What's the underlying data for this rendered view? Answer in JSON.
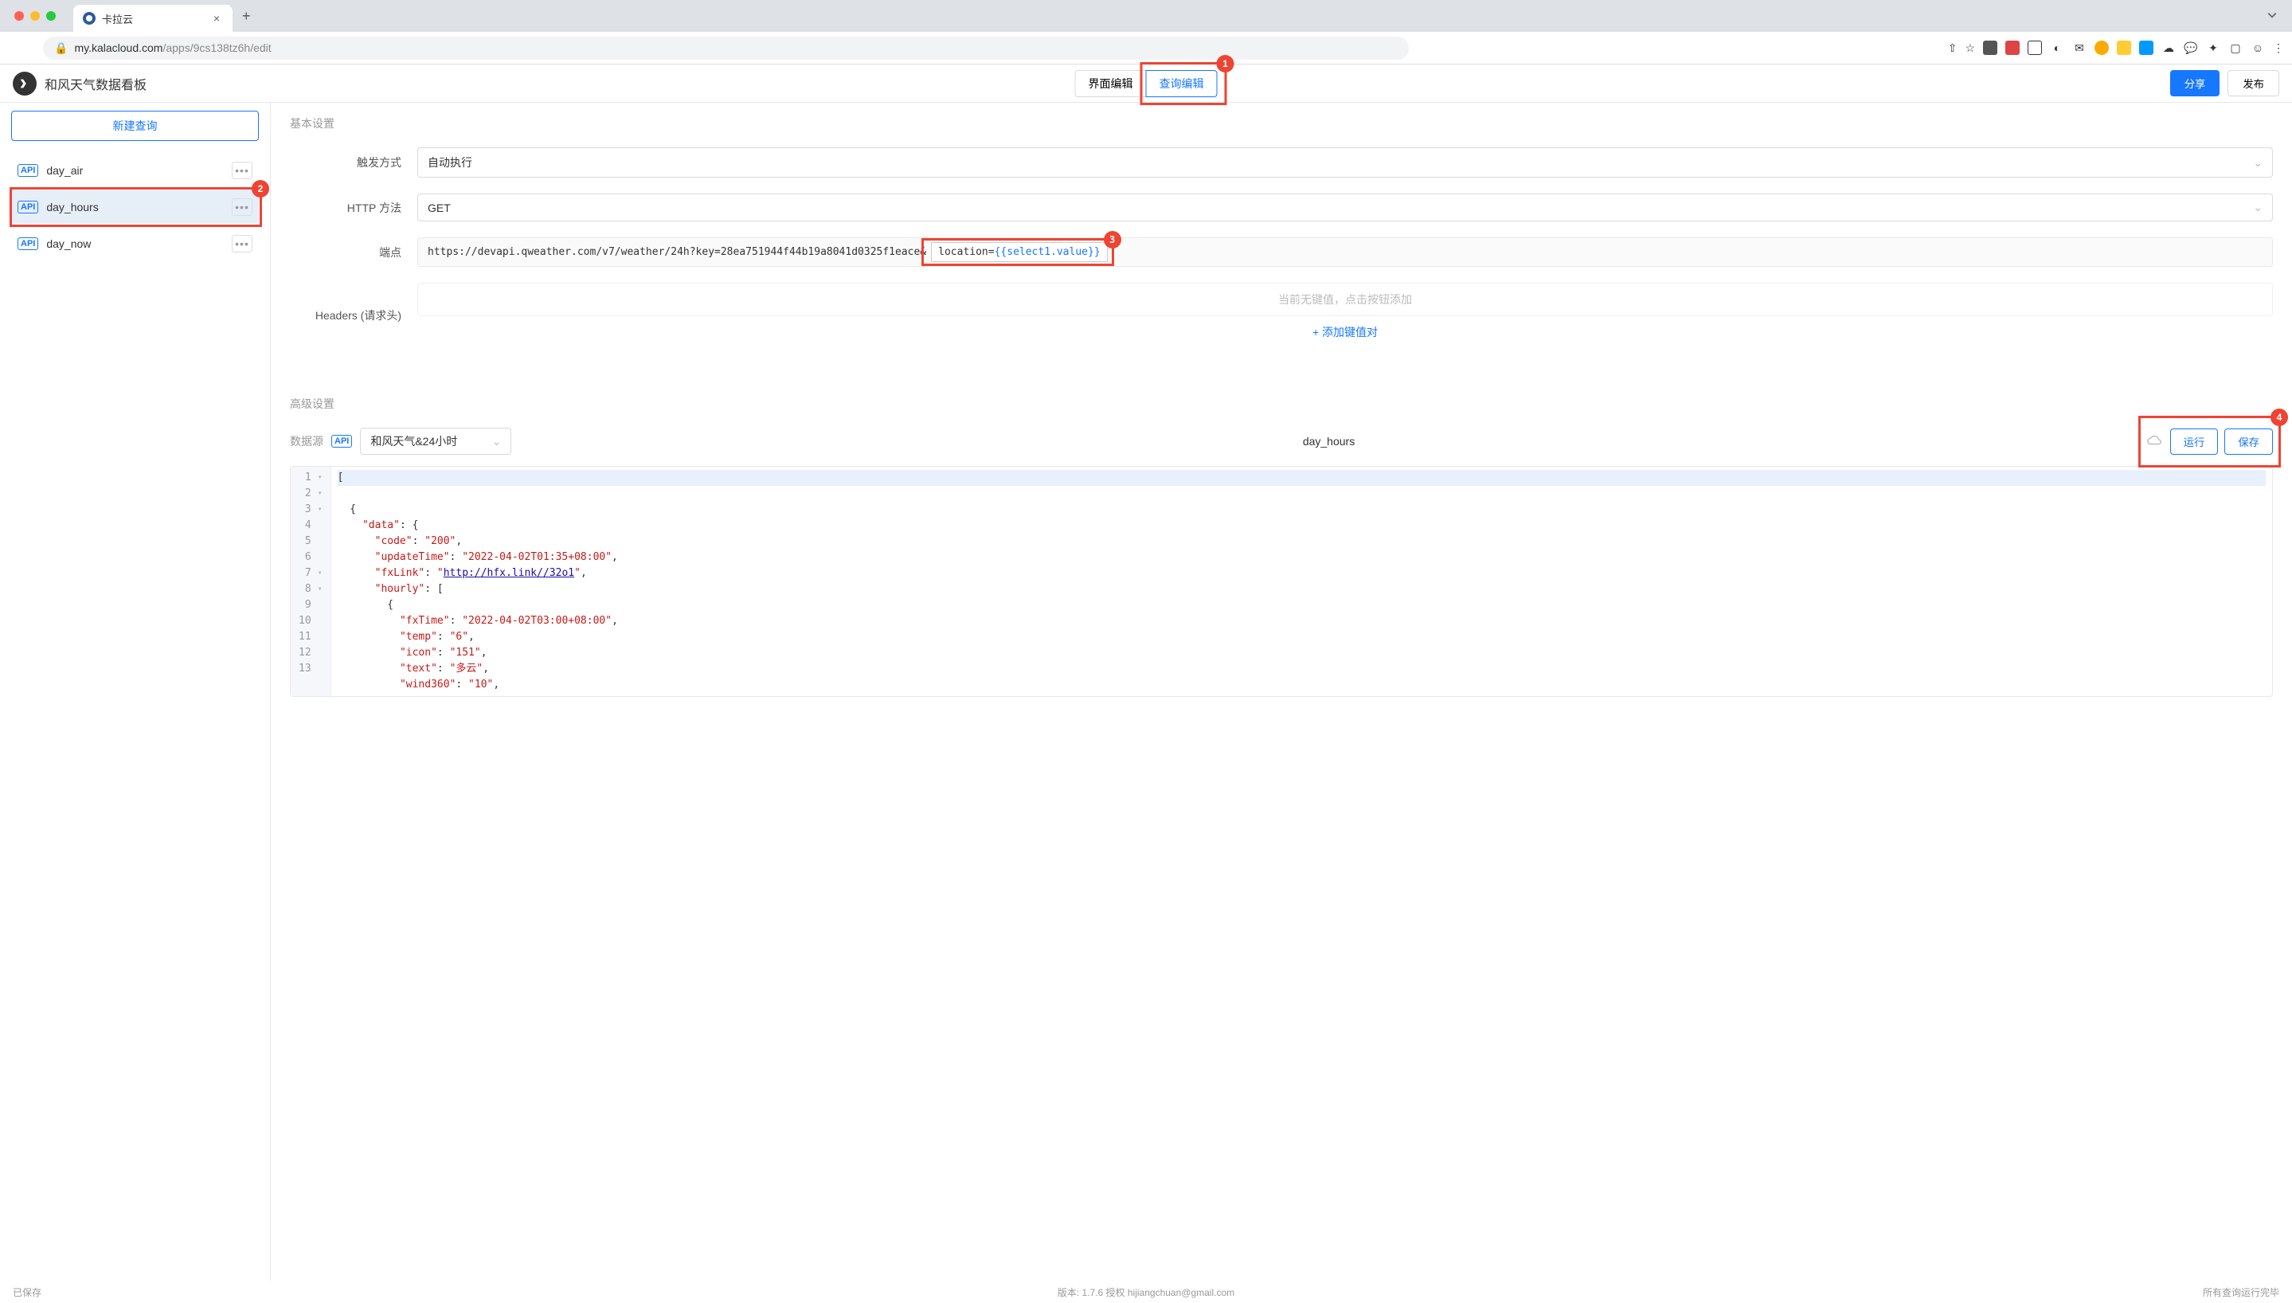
{
  "browser": {
    "tab_title": "卡拉云",
    "url_host": "my.kalacloud.com",
    "url_path": "/apps/9cs138tz6h/edit"
  },
  "app": {
    "title": "和风天气数据看板",
    "mode_ui": "界面编辑",
    "mode_query": "查询编辑",
    "share": "分享",
    "publish": "发布"
  },
  "sidebar": {
    "new_query": "新建查询",
    "items": [
      {
        "name": "day_air"
      },
      {
        "name": "day_hours"
      },
      {
        "name": "day_now"
      }
    ]
  },
  "form": {
    "basic_title": "基本设置",
    "trigger_label": "触发方式",
    "trigger_value": "自动执行",
    "method_label": "HTTP 方法",
    "method_value": "GET",
    "endpoint_label": "端点",
    "endpoint_static": "https://devapi.qweather.com/v7/weather/24h?key=28ea751944f44b19a8041d0325f1eace&",
    "endpoint_dynamic_prefix": "location=",
    "endpoint_dynamic_template": "{{select1.value}}",
    "headers_label": "Headers (请求头)",
    "headers_placeholder": "当前无键值，点击按钮添加",
    "add_kv": "+ 添加键值对"
  },
  "adv": {
    "title": "高级设置",
    "ds_label": "数据源",
    "ds_value": "和风天气&24小时",
    "query_name": "day_hours",
    "run": "运行",
    "save": "保存"
  },
  "code": {
    "lines": [
      "[",
      "  {",
      "    \"data\": {",
      "      \"code\": \"200\",",
      "      \"updateTime\": \"2022-04-02T01:35+08:00\",",
      "      \"fxLink\": \"http://hfx.link/32o1\",",
      "      \"hourly\": [",
      "        {",
      "          \"fxTime\": \"2022-04-02T03:00+08:00\",",
      "          \"temp\": \"6\",",
      "          \"icon\": \"151\",",
      "          \"text\": \"多云\",",
      "          \"wind360\": \"10\","
    ]
  },
  "footer": {
    "saved": "已保存",
    "version": "版本: 1.7.6 授权 hijiangchuan@gmail.com",
    "status": "所有查询运行完毕"
  },
  "annotations": [
    "1",
    "2",
    "3",
    "4"
  ]
}
